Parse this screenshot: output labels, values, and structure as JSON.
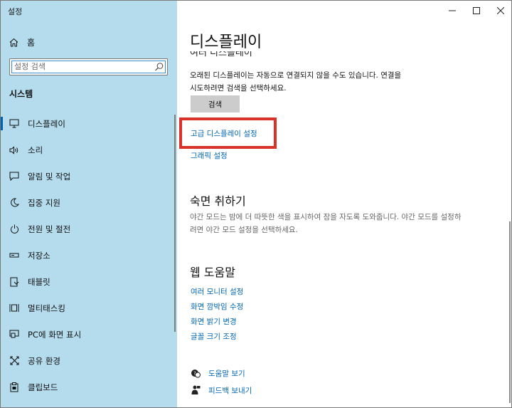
{
  "app": {
    "title": "설정"
  },
  "window_controls": {
    "minimize": "—",
    "maximize": "☐",
    "close": "✕"
  },
  "sidebar": {
    "home_label": "홈",
    "search_placeholder": "설정 검색",
    "section_label": "시스템",
    "items": [
      {
        "label": "디스플레이",
        "icon": "monitor-icon",
        "active": true
      },
      {
        "label": "소리",
        "icon": "speaker-icon"
      },
      {
        "label": "알림 및 작업",
        "icon": "notification-icon"
      },
      {
        "label": "집중 지원",
        "icon": "moon-icon"
      },
      {
        "label": "전원 및 절전",
        "icon": "power-icon"
      },
      {
        "label": "저장소",
        "icon": "storage-icon"
      },
      {
        "label": "태블릿",
        "icon": "tablet-icon"
      },
      {
        "label": "멀티태스킹",
        "icon": "multitasking-icon"
      },
      {
        "label": "PC에 화면 표시",
        "icon": "project-icon"
      },
      {
        "label": "공유 환경",
        "icon": "share-icon"
      },
      {
        "label": "클립보드",
        "icon": "clipboard-icon"
      }
    ]
  },
  "main": {
    "page_title": "디스플레이",
    "clipped_heading": "여러 디스플레이",
    "detect_text_line1": "오래된 디스플레이는 자동으로 연결되지 않을 수도 있습니다. 연결을",
    "detect_text_line2": "시도하려면 검색을 선택하세요.",
    "detect_button": "검색",
    "advanced_link": "고급 디스플레이 설정",
    "graphics_link": "그래픽 설정",
    "sleep_heading": "숙면 취하기",
    "sleep_text_line1": "야간 모드는 밤에 더 따뜻한 색을 표시하여 잠을 자도록 도와줍니다. 야간 모드를 설정하",
    "sleep_text_line2": "려면 야간 모드 설정을 선택하세요.",
    "web_help_heading": "웹 도움말",
    "web_links": [
      "여러 모니터 설정",
      "화면 깜박임 수정",
      "화면 밝기 변경",
      "글꼴 크기 조정"
    ],
    "help_get": "도움말 보기",
    "feedback": "피드백 보내기"
  },
  "colors": {
    "sidebar_bg": "#b4dced",
    "accent": "#0066b4",
    "highlight": "#d9322a"
  }
}
